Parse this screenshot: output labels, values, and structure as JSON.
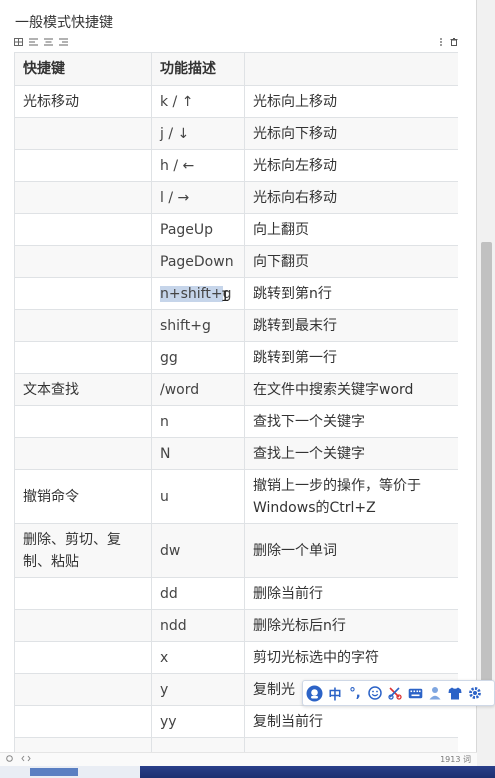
{
  "document": {
    "title": "一般模式快捷键"
  },
  "toolbar": {
    "left_icons": [
      "table-icon",
      "align-left-icon",
      "align-center-icon",
      "align-right-icon"
    ],
    "right_icons": [
      "more-icon",
      "delete-icon"
    ]
  },
  "table": {
    "headers": [
      "快捷键",
      "功能描述",
      ""
    ],
    "rows": [
      {
        "c1": "光标移动",
        "c2": "k / ↑",
        "c3": "光标向上移动"
      },
      {
        "c1": "",
        "c2": "j / ↓",
        "c3": "光标向下移动"
      },
      {
        "c1": "",
        "c2": "h / ←",
        "c3": "光标向左移动"
      },
      {
        "c1": "",
        "c2": "l / →",
        "c3": "光标向右移动"
      },
      {
        "c1": "",
        "c2": "PageUp",
        "c3": "向上翻页"
      },
      {
        "c1": "",
        "c2": "PageDown",
        "c3": "向下翻页"
      },
      {
        "c1": "",
        "c2": "n+shift+g",
        "c3": "跳转到第n行"
      },
      {
        "c1": "",
        "c2": "shift+g",
        "c3": "跳转到最末行"
      },
      {
        "c1": "",
        "c2": "gg",
        "c3": "跳转到第一行"
      },
      {
        "c1": "文本查找",
        "c2": "/word",
        "c3": "在文件中搜索关键字word"
      },
      {
        "c1": "",
        "c2": "n",
        "c3": "查找下一个关键字"
      },
      {
        "c1": "",
        "c2": "N",
        "c3": "查找上一个关键字"
      },
      {
        "c1": "撤销命令",
        "c2": "u",
        "c3": "撤销上一步的操作，等价于Windows的Ctrl+Z"
      },
      {
        "c1": "删除、剪切、复制、粘贴",
        "c2": "dw",
        "c3": "删除一个单词"
      },
      {
        "c1": "",
        "c2": "dd",
        "c3": "删除当前行"
      },
      {
        "c1": "",
        "c2": "ndd",
        "c3": "删除光标后n行"
      },
      {
        "c1": "",
        "c2": "x",
        "c3": "剪切光标选中的字符"
      },
      {
        "c1": "",
        "c2": "y",
        "c3": "复制光"
      },
      {
        "c1": "",
        "c2": "yy",
        "c3": "复制当前行"
      },
      {
        "c1": "",
        "c2": "",
        "c3": ""
      }
    ]
  },
  "selection": {
    "highlighted_text": "n+shift+",
    "remaining_text": "g"
  },
  "status_bar": {
    "word_count": "1913 词"
  },
  "ime_toolbar": {
    "lang_label": "中",
    "punct_label": "°,",
    "items": [
      "ime-logo-icon",
      "chinese-mode",
      "punctuation-icon",
      "emoji-icon",
      "scissors-icon",
      "keyboard-icon",
      "user-icon",
      "skin-icon",
      "settings-icon"
    ]
  },
  "colors": {
    "ime_blue": "#2c63c7",
    "selection": "#c6d5ea",
    "taskbar": "#1d2f70"
  }
}
